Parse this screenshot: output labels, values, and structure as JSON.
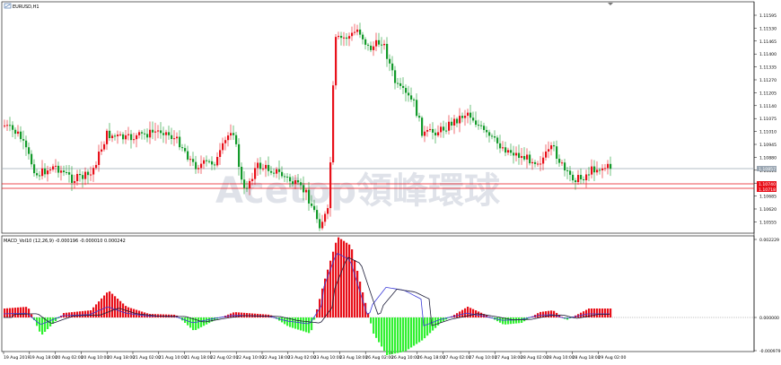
{
  "window": {
    "symbol_title": "EURUSD,H1"
  },
  "watermark": "Acetop領峰環球",
  "price_axis": {
    "ticks": [
      "1.11595",
      "1.11530",
      "1.11465",
      "1.11400",
      "1.11335",
      "1.11270",
      "1.11205",
      "1.11140",
      "1.11075",
      "1.11010",
      "1.10945",
      "1.10880",
      "1.10815",
      "1.10750",
      "1.10685",
      "1.10620",
      "1.10555"
    ],
    "current_bid": "1.10857",
    "line_level_1": "1.10740",
    "line_level_2": "1.10718"
  },
  "macd": {
    "title": "MACD_Vol10 (12,26,9) -0.000196 -0.000010 0.000242",
    "ticks": [
      "0.002229",
      "0.000000",
      "-0.000979"
    ]
  },
  "time_axis": {
    "labels": [
      "19 Aug 2019",
      "19 Aug 18:00",
      "20 Aug 02:00",
      "20 Aug 10:00",
      "20 Aug 18:00",
      "21 Aug 02:00",
      "21 Aug 10:00",
      "21 Aug 18:00",
      "22 Aug 02:00",
      "22 Aug 10:00",
      "22 Aug 18:00",
      "23 Aug 02:00",
      "23 Aug 10:00",
      "23 Aug 18:00",
      "26 Aug 02:00",
      "26 Aug 10:00",
      "26 Aug 18:00",
      "27 Aug 02:00",
      "27 Aug 10:00",
      "27 Aug 18:00",
      "28 Aug 02:00",
      "28 Aug 10:00",
      "28 Aug 18:00",
      "29 Aug 02:00"
    ]
  },
  "colors": {
    "bull": "#e8101a",
    "bear": "#139a2b",
    "macd_pos": "#e8101a",
    "macd_neg": "#32f032",
    "level_line": "#e8101a",
    "bid_line": "#9aa6b2"
  }
}
